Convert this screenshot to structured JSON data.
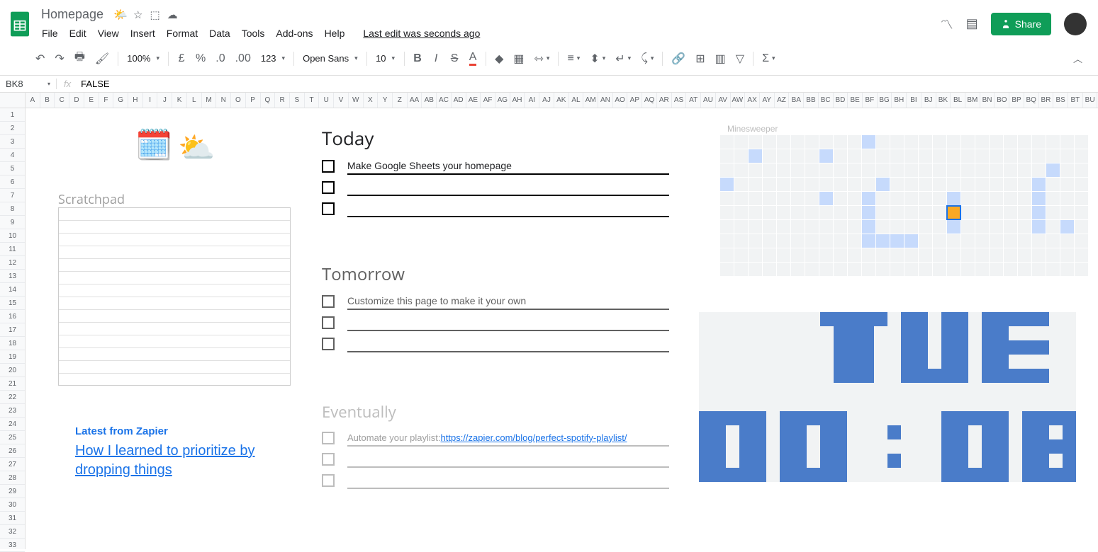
{
  "document": {
    "title": "Homepage",
    "title_emoji": "🌤️",
    "last_edit": "Last edit was seconds ago"
  },
  "menus": [
    "File",
    "Edit",
    "View",
    "Insert",
    "Format",
    "Data",
    "Tools",
    "Add-ons",
    "Help"
  ],
  "toolbar": {
    "zoom": "100%",
    "font": "Open Sans",
    "font_size": "10"
  },
  "share_label": "Share",
  "name_box": "BK8",
  "formula": "FALSE",
  "columns": [
    "A",
    "B",
    "C",
    "D",
    "E",
    "F",
    "G",
    "H",
    "I",
    "J",
    "K",
    "L",
    "M",
    "N",
    "O",
    "P",
    "Q",
    "R",
    "S",
    "T",
    "U",
    "V",
    "W",
    "X",
    "Y",
    "Z",
    "AA",
    "AB",
    "AC",
    "AD",
    "AE",
    "AF",
    "AG",
    "AH",
    "AI",
    "AJ",
    "AK",
    "AL",
    "AM",
    "AN",
    "AO",
    "AP",
    "AQ",
    "AR",
    "AS",
    "AT",
    "AU",
    "AV",
    "AW",
    "AX",
    "AY",
    "AZ",
    "BA",
    "BB",
    "BC",
    "BD",
    "BE",
    "BF",
    "BG",
    "BH",
    "BI",
    "BJ",
    "BK",
    "BL",
    "BM",
    "BN",
    "BO",
    "BP",
    "BQ",
    "BR",
    "BS",
    "BT",
    "BU"
  ],
  "rows": 33,
  "scratchpad": {
    "title": "Scratchpad"
  },
  "sections": {
    "today": {
      "title": "Today",
      "items": [
        "Make Google Sheets your homepage",
        "",
        ""
      ]
    },
    "tomorrow": {
      "title": "Tomorrow",
      "items": [
        "Customize this page to make it your own",
        "",
        ""
      ]
    },
    "eventually": {
      "title": "Eventually",
      "prefix": "Automate your playlist: ",
      "link": "https://zapier.com/blog/perfect-spotify-playlist/",
      "items": [
        "",
        "",
        ""
      ]
    }
  },
  "zapier": {
    "heading": "Latest from Zapier",
    "headline": "How I learned to prioritize by dropping things"
  },
  "minesweeper": {
    "label": "Minesweeper"
  },
  "clock": {
    "day": "TUE",
    "time": "00:08"
  }
}
